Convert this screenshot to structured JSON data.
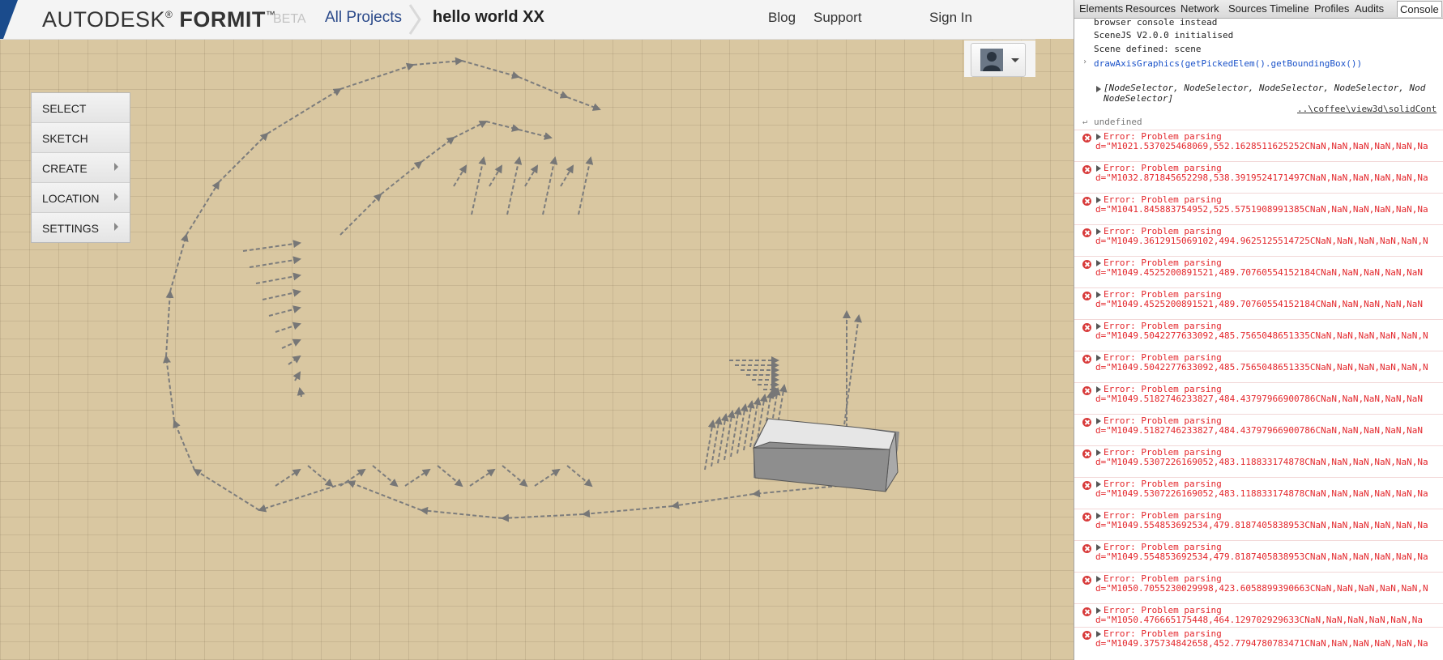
{
  "app": {
    "logo": {
      "brand": "AUTODESK",
      "reg": "®",
      "product": "FORMIT",
      "tm": "™"
    },
    "beta": "BETA",
    "breadcrumb": {
      "all_projects": "All Projects",
      "project": "hello world XX"
    },
    "nav": {
      "blog": "Blog",
      "support": "Support",
      "sign_in": "Sign In"
    },
    "menu": [
      {
        "label": "SELECT",
        "has_submenu": false
      },
      {
        "label": "SKETCH",
        "has_submenu": false
      },
      {
        "label": "CREATE",
        "has_submenu": true
      },
      {
        "label": "LOCATION",
        "has_submenu": true
      },
      {
        "label": "SETTINGS",
        "has_submenu": true
      }
    ],
    "colors": {
      "ground": "#d9c7a1",
      "arrows": "#7a7a7a",
      "title_link": "#2b4a8a"
    }
  },
  "devtools": {
    "tabs": [
      "Elements",
      "Resources",
      "Network",
      "Sources",
      "Timeline",
      "Profiles",
      "Audits",
      "Console"
    ],
    "active_tab": "Console",
    "console": {
      "lines": [
        "browser console instead",
        "SceneJS V2.0.0 initialised",
        "Scene defined: scene"
      ],
      "command": "drawAxisGraphics(getPickedElem().getBoundingBox())",
      "result_array": "[NodeSelector, NodeSelector, NodeSelector, NodeSelector, NodeSelector, NodeSelector]",
      "result_array_line1": "[NodeSelector, NodeSelector, NodeSelector, NodeSelector, Nod",
      "result_array_line2": "NodeSelector]",
      "source_link": "..\\coffee\\view3d\\solidCont",
      "undefined": "undefined",
      "error_title": "Error: Problem parsing",
      "errors": [
        "d=\"M1021.537025468069,552.1628511625252CNaN,NaN,NaN,NaN,NaN,Na",
        "d=\"M1032.871845652298,538.3919524171497CNaN,NaN,NaN,NaN,NaN,Na",
        "d=\"M1041.845883754952,525.5751908991385CNaN,NaN,NaN,NaN,NaN,Na",
        "d=\"M1049.3612915069102,494.9625125514725CNaN,NaN,NaN,NaN,NaN,N",
        "d=\"M1049.4525200891521,489.70760554152184CNaN,NaN,NaN,NaN,NaN",
        "d=\"M1049.4525200891521,489.70760554152184CNaN,NaN,NaN,NaN,NaN",
        "d=\"M1049.5042277633092,485.7565048651335CNaN,NaN,NaN,NaN,NaN,N",
        "d=\"M1049.5042277633092,485.7565048651335CNaN,NaN,NaN,NaN,NaN,N",
        "d=\"M1049.5182746233827,484.43797966900786CNaN,NaN,NaN,NaN,NaN",
        "d=\"M1049.5182746233827,484.43797966900786CNaN,NaN,NaN,NaN,NaN",
        "d=\"M1049.5307226169052,483.118833174878CNaN,NaN,NaN,NaN,NaN,Na",
        "d=\"M1049.5307226169052,483.118833174878CNaN,NaN,NaN,NaN,NaN,Na",
        "d=\"M1049.554853692534,479.8187405838953CNaN,NaN,NaN,NaN,NaN,Na",
        "d=\"M1049.554853692534,479.8187405838953CNaN,NaN,NaN,NaN,NaN,Na",
        "d=\"M1050.7055230029998,423.6058899390663CNaN,NaN,NaN,NaN,NaN,N",
        "d=\"M1050.476665175448,464.129702929633CNaN,NaN,NaN,NaN,NaN,Na",
        "d=\"M1049.375734842658,452.7794780783471CNaN,NaN,NaN,NaN,NaN,Na"
      ]
    }
  }
}
